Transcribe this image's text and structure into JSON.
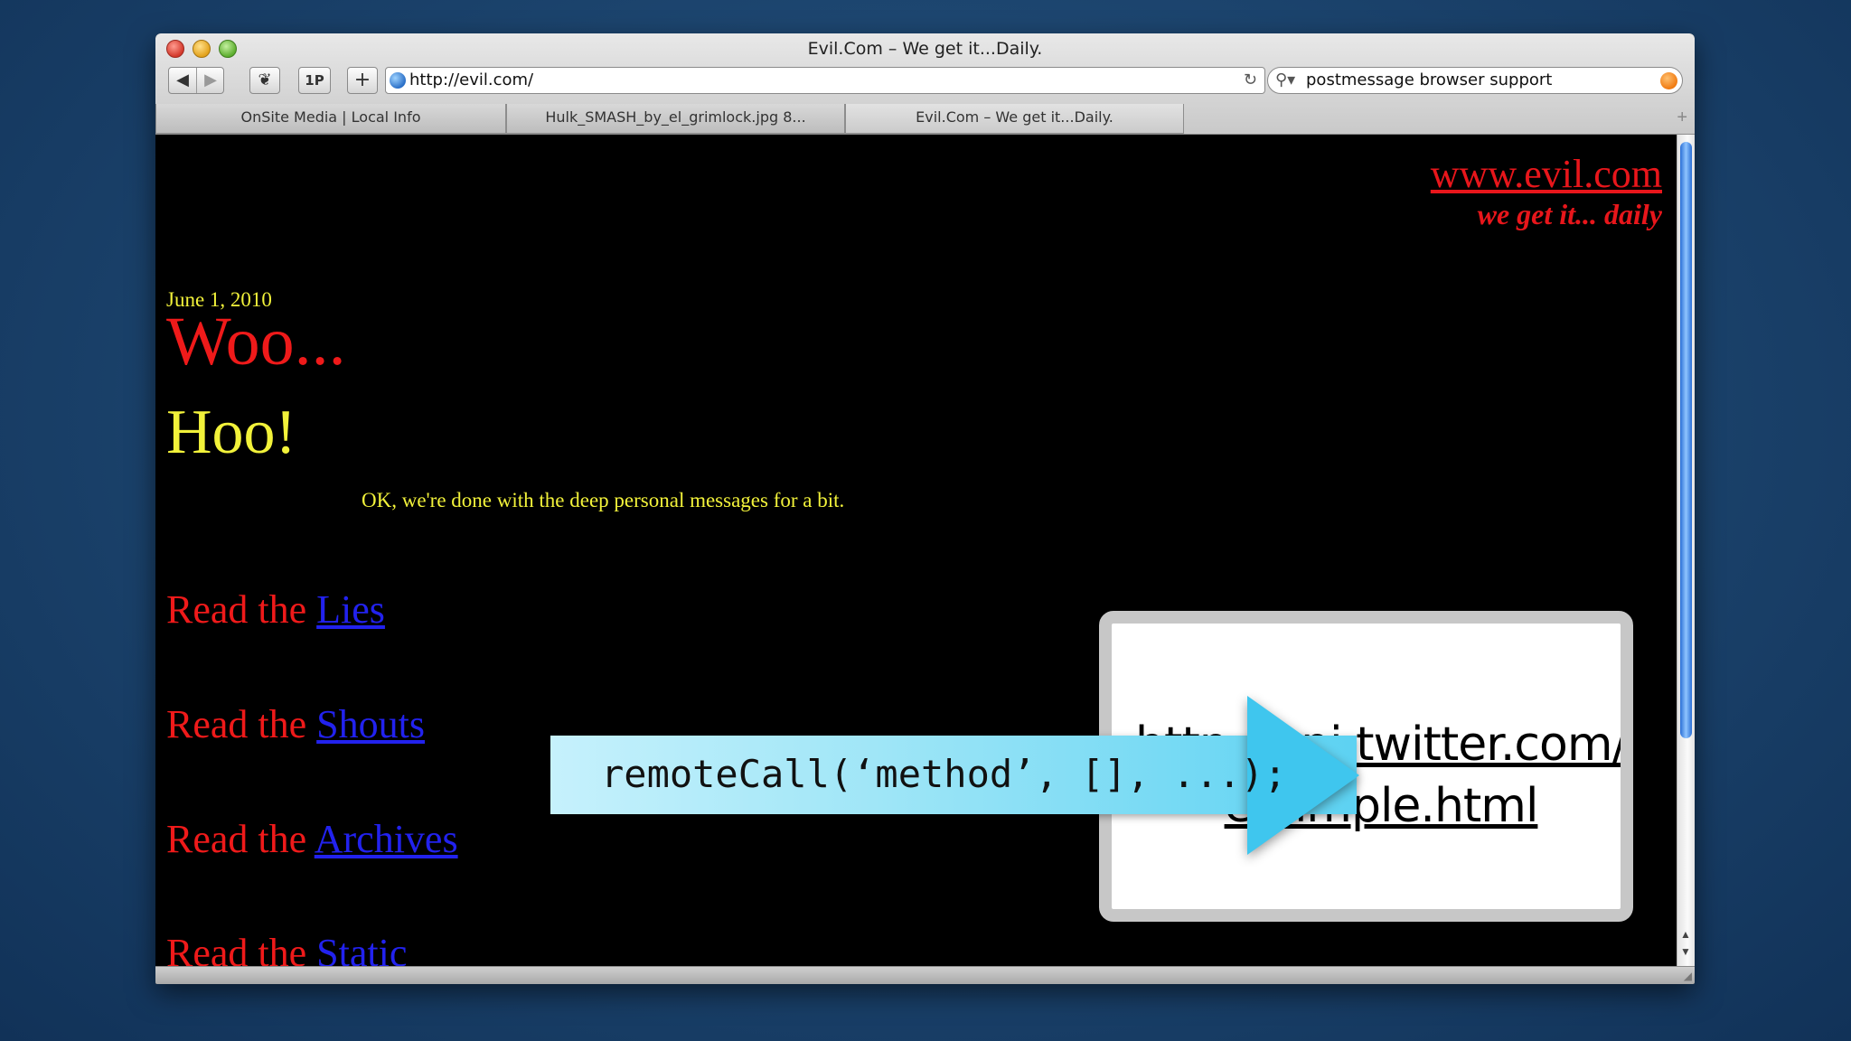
{
  "window": {
    "title": "Evil.Com – We get it...Daily."
  },
  "toolbar": {
    "back_icon": "◀",
    "forward_icon": "▶",
    "evernote_icon": "❦",
    "onepassword_label": "1P",
    "add_bookmark_label": "+",
    "reload_icon": "↻",
    "url": "http://evil.com/",
    "search_query": "postmessage browser support",
    "search_icon": "⚲▾"
  },
  "tabs": [
    {
      "label": "OnSite Media | Local Info"
    },
    {
      "label": "Hulk_SMASH_by_el_grimlock.jpg 8..."
    },
    {
      "label": "Evil.Com – We get it...Daily."
    }
  ],
  "tab_add_label": "+",
  "page": {
    "site_link": "www.evil.com",
    "site_tagline": "we get it... daily",
    "date": "June 1, 2010",
    "headline1": "Woo...",
    "headline2": "Hoo!",
    "message": "OK, we're done with the deep personal messages for a bit.",
    "read_prefix": "Read the",
    "links": [
      "Lies",
      "Shouts",
      "Archives",
      "Static"
    ]
  },
  "overlay": {
    "iframe_url_line1": "http://api.twitter.com/",
    "iframe_url_line2": "example.html",
    "callout_code": "remoteCall(‘method’, [], ...);"
  },
  "colors": {
    "site_red": "#e8161b",
    "site_yellow": "#f2f23a",
    "link_blue": "#2222ee",
    "callout_cyan": "#5dd2f2"
  }
}
